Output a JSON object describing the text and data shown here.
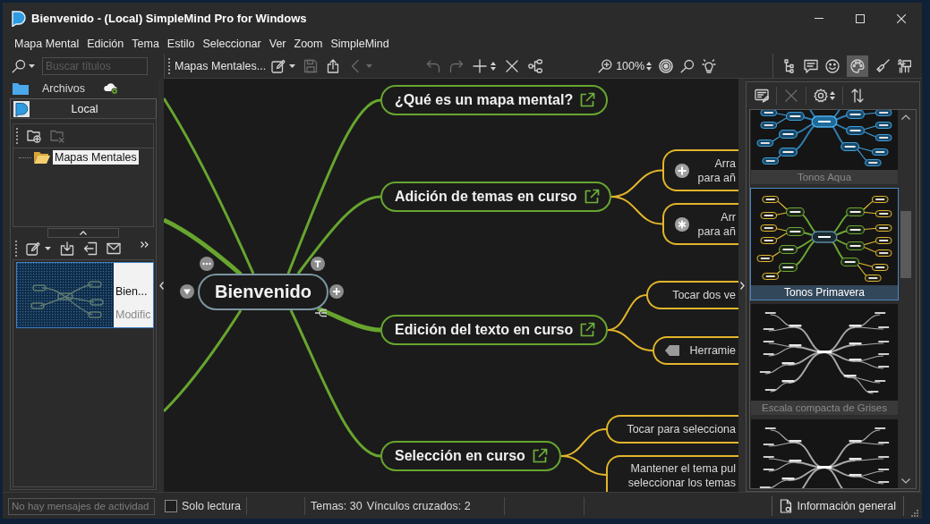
{
  "window": {
    "title": "Bienvenido - (Local) SimpleMind Pro for Windows"
  },
  "menu_bar": [
    "Mapa Mental",
    "Edición",
    "Tema",
    "Estilo",
    "Seleccionar",
    "Ver",
    "Zoom",
    "SimpleMind"
  ],
  "search": {
    "placeholder": "Buscar títulos"
  },
  "storage": {
    "header": "Archivos",
    "locations": [
      {
        "label": "Local",
        "selected": true
      }
    ]
  },
  "folder_tools": [
    {
      "kind": "new-folder",
      "disabled": false
    },
    {
      "kind": "delete-folder",
      "disabled": true
    }
  ],
  "folders": [
    {
      "label": "Mapas Mentales",
      "selected": true
    }
  ],
  "document_tools": [
    {
      "kind": "edit"
    },
    {
      "kind": "import"
    },
    {
      "kind": "export"
    },
    {
      "kind": "mail"
    }
  ],
  "documents": [
    {
      "title": "Bien...",
      "subtitle": "Modific",
      "selected": true
    }
  ],
  "toolbar": {
    "breadcrumb": "Mapas Mentales...",
    "file_tools": [
      {
        "kind": "edit",
        "disabled": false
      },
      {
        "kind": "save",
        "disabled": true
      },
      {
        "kind": "share",
        "disabled": false
      },
      {
        "kind": "back",
        "disabled": true
      }
    ],
    "edit_tools": [
      {
        "kind": "undo",
        "disabled": true
      },
      {
        "kind": "redo",
        "disabled": true
      },
      {
        "kind": "add",
        "disabled": false
      },
      {
        "kind": "delete",
        "disabled": false
      },
      {
        "kind": "connect",
        "disabled": false
      }
    ],
    "zoom": "100%",
    "view_tools": [
      {
        "kind": "target"
      },
      {
        "kind": "find"
      },
      {
        "kind": "idea"
      }
    ],
    "panel_tools": [
      {
        "kind": "outline",
        "selected": false
      },
      {
        "kind": "notes",
        "selected": false
      },
      {
        "kind": "emoji",
        "selected": false
      },
      {
        "kind": "style",
        "selected": true
      },
      {
        "kind": "format",
        "selected": false
      },
      {
        "kind": "presentation",
        "selected": false
      }
    ]
  },
  "mind_map": {
    "central": "Bienvenido",
    "topics": [
      {
        "label": "¿Qué es un mapa mental?"
      },
      {
        "label": "Adición de temas en curso",
        "children": [
          {
            "kind": "plus",
            "lines": [
              "Arra",
              "para añ"
            ]
          },
          {
            "kind": "asterisk",
            "lines": [
              "Arr",
              "para añ"
            ]
          }
        ]
      },
      {
        "label": "Edición del texto en curso",
        "children": [
          {
            "kind": "plain",
            "lines": [
              "Tocar dos ve"
            ]
          },
          {
            "kind": "tag",
            "lines": [
              "Herramie"
            ]
          }
        ]
      },
      {
        "label": "Selección en curso",
        "children": [
          {
            "kind": "plain",
            "lines": [
              "Tocar para selecciona"
            ]
          },
          {
            "kind": "plain",
            "lines": [
              "Mantener el tema pul",
              "seleccionar los temas"
            ]
          }
        ]
      }
    ]
  },
  "style_gallery": {
    "tools": [
      {
        "kind": "edit-list",
        "disabled": false
      },
      {
        "kind": "delete",
        "disabled": true
      },
      {
        "kind": "settings",
        "disabled": false
      },
      {
        "kind": "sort",
        "disabled": false
      }
    ],
    "styles": [
      {
        "label": "Tonos Aqua",
        "kind": "aqua",
        "selected": false
      },
      {
        "label": "Tonos Primavera",
        "kind": "spring",
        "selected": true
      },
      {
        "label": "Escala compacta de Grises",
        "kind": "gray",
        "selected": false
      },
      {
        "kind": "gray",
        "selected": false
      }
    ]
  },
  "status_bar": {
    "activity": "No hay mensajes de actividad",
    "read_only": {
      "label": "Solo lectura",
      "checked": false
    },
    "topic_count": "Temas: 30",
    "cross_links": "Vínculos cruzados: 2",
    "overview_button": "Información general"
  }
}
